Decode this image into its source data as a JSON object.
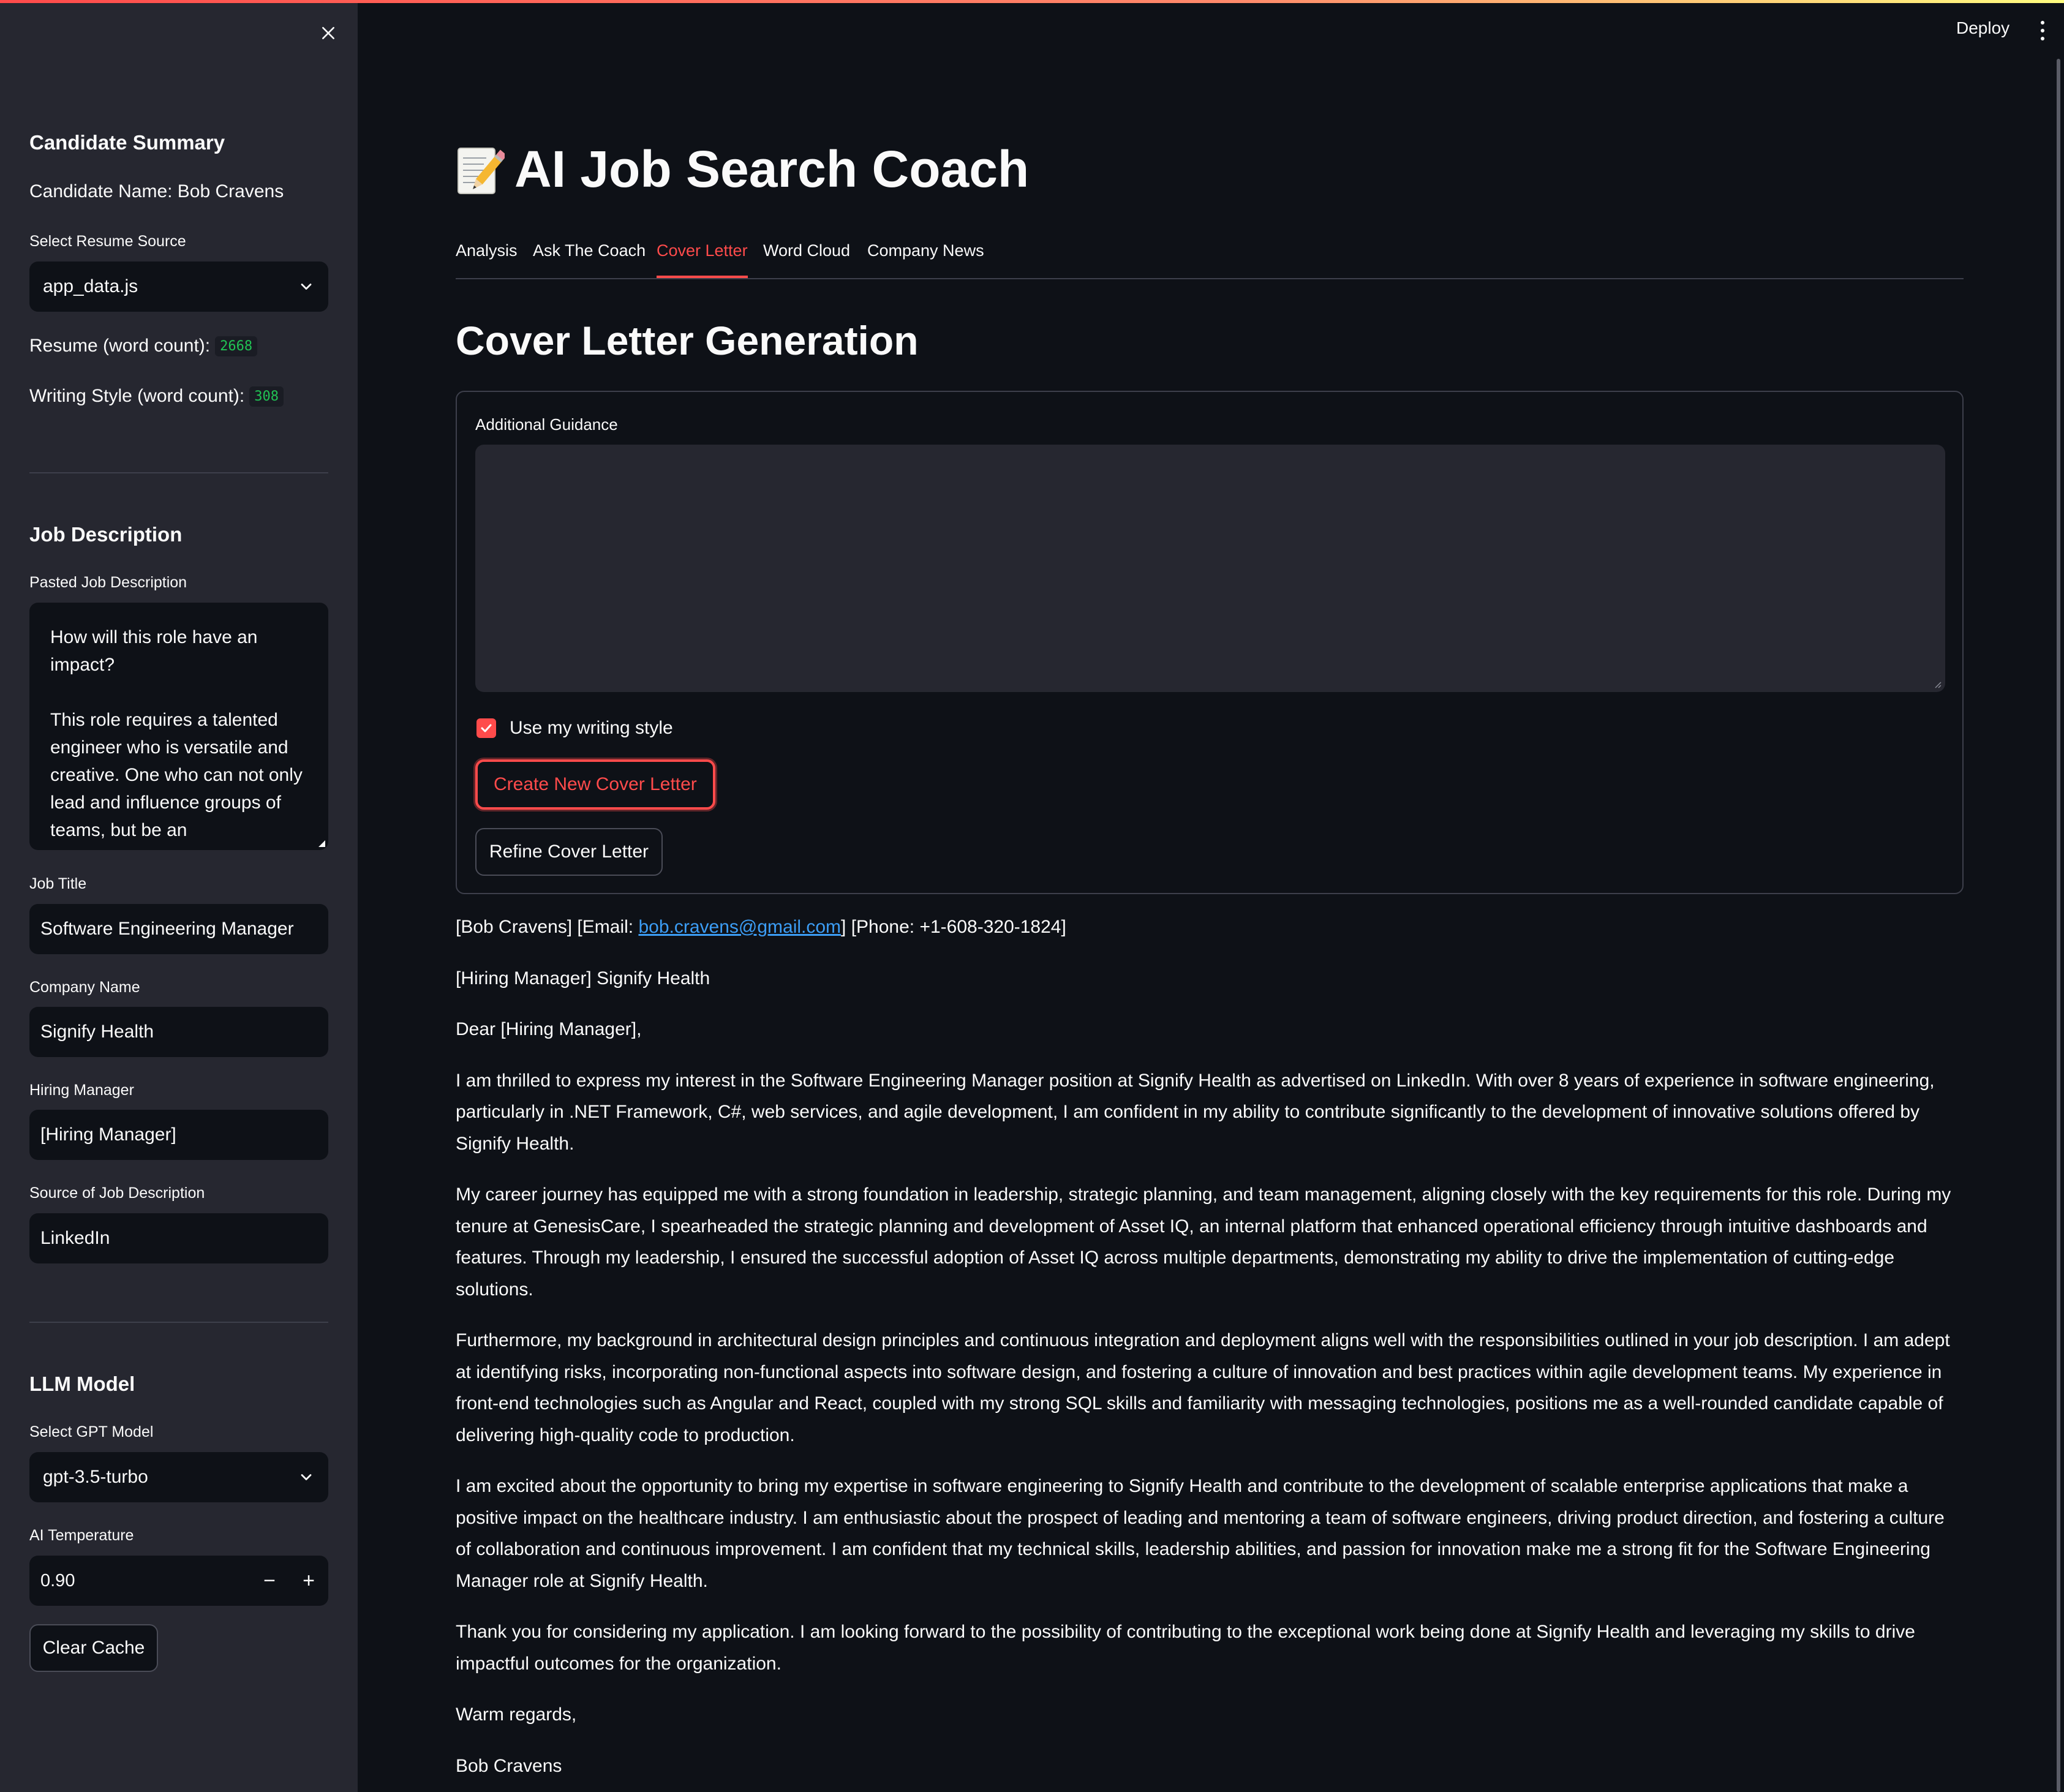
{
  "header": {
    "deploy_label": "Deploy"
  },
  "sidebar": {
    "candidate_summary_heading": "Candidate Summary",
    "candidate_name": "Candidate Name: Bob Cravens",
    "resume_source_label": "Select Resume Source",
    "resume_source_value": "app_data.js",
    "resume_word_count_label": "Resume (word count):",
    "resume_word_count": "2668",
    "writing_style_label": "Writing Style (word count):",
    "writing_style_count": "308",
    "job_description_heading": "Job Description",
    "pasted_job_description_label": "Pasted Job Description",
    "pasted_job_description_text": "How will this role have an impact?\n\nThis role requires a talented engineer who is versatile and creative. One who can not only lead and influence groups of teams, but be an",
    "job_title_label": "Job Title",
    "job_title_value": "Software Engineering Manager",
    "company_name_label": "Company Name",
    "company_name_value": "Signify Health",
    "hiring_manager_label": "Hiring Manager",
    "hiring_manager_value": "[Hiring Manager]",
    "source_label": "Source of Job Description",
    "source_value": "LinkedIn",
    "llm_heading": "LLM Model",
    "gpt_model_label": "Select GPT Model",
    "gpt_model_value": "gpt-3.5-turbo",
    "temperature_label": "AI Temperature",
    "temperature_value": "0.90",
    "stepper_minus": "−",
    "stepper_plus": "+",
    "clear_cache_label": "Clear Cache"
  },
  "main": {
    "title": "AI Job Search Coach",
    "title_icon": "memo-pencil-icon",
    "tabs": [
      {
        "label": "Analysis",
        "active": false
      },
      {
        "label": "Ask The Coach",
        "active": false
      },
      {
        "label": "Cover Letter",
        "active": true
      },
      {
        "label": "Word Cloud",
        "active": false
      },
      {
        "label": "Company News",
        "active": false
      }
    ],
    "section_title": "Cover Letter Generation",
    "form": {
      "guidance_label": "Additional Guidance",
      "guidance_value": "",
      "use_style_label": "Use my writing style",
      "use_style_checked": true,
      "create_button": "Create New Cover Letter",
      "refine_button": "Refine Cover Letter"
    },
    "letter": {
      "line1_prefix": "[Bob Cravens] [Email: ",
      "email": "bob.cravens@gmail.com",
      "line1_suffix": "] [Phone: +1-608-320-1824]",
      "line2": "[Hiring Manager] Signify Health",
      "salutation": "Dear [Hiring Manager],",
      "paragraphs": [
        "I am thrilled to express my interest in the Software Engineering Manager position at Signify Health as advertised on LinkedIn. With over 8 years of experience in software engineering, particularly in .NET Framework, C#, web services, and agile development, I am confident in my ability to contribute significantly to the development of innovative solutions offered by Signify Health.",
        "My career journey has equipped me with a strong foundation in leadership, strategic planning, and team management, aligning closely with the key requirements for this role. During my tenure at GenesisCare, I spearheaded the strategic planning and development of Asset IQ, an internal platform that enhanced operational efficiency through intuitive dashboards and features. Through my leadership, I ensured the successful adoption of Asset IQ across multiple departments, demonstrating my ability to drive the implementation of cutting-edge solutions.",
        "Furthermore, my background in architectural design principles and continuous integration and deployment aligns well with the responsibilities outlined in your job description. I am adept at identifying risks, incorporating non-functional aspects into software design, and fostering a culture of innovation and best practices within agile development teams. My experience in front-end technologies such as Angular and React, coupled with my strong SQL skills and familiarity with messaging technologies, positions me as a well-rounded candidate capable of delivering high-quality code to production.",
        "I am excited about the opportunity to bring my expertise in software engineering to Signify Health and contribute to the development of scalable enterprise applications that make a positive impact on the healthcare industry. I am enthusiastic about the prospect of leading and mentoring a team of software engineers, driving product direction, and fostering a culture of collaboration and continuous improvement. I am confident that my technical skills, leadership abilities, and passion for innovation make me a strong fit for the Software Engineering Manager role at Signify Health.",
        "Thank you for considering my application. I am looking forward to the possibility of contributing to the exceptional work being done at Signify Health and leveraging my skills to drive impactful outcomes for the organization."
      ],
      "closing": "Warm regards,",
      "signature": "Bob Cravens"
    }
  },
  "colors": {
    "background": "#0e1117",
    "sidebar": "#262730",
    "accent": "#ff4b4b",
    "badge_text": "#21c354",
    "link": "#3c9df5"
  }
}
